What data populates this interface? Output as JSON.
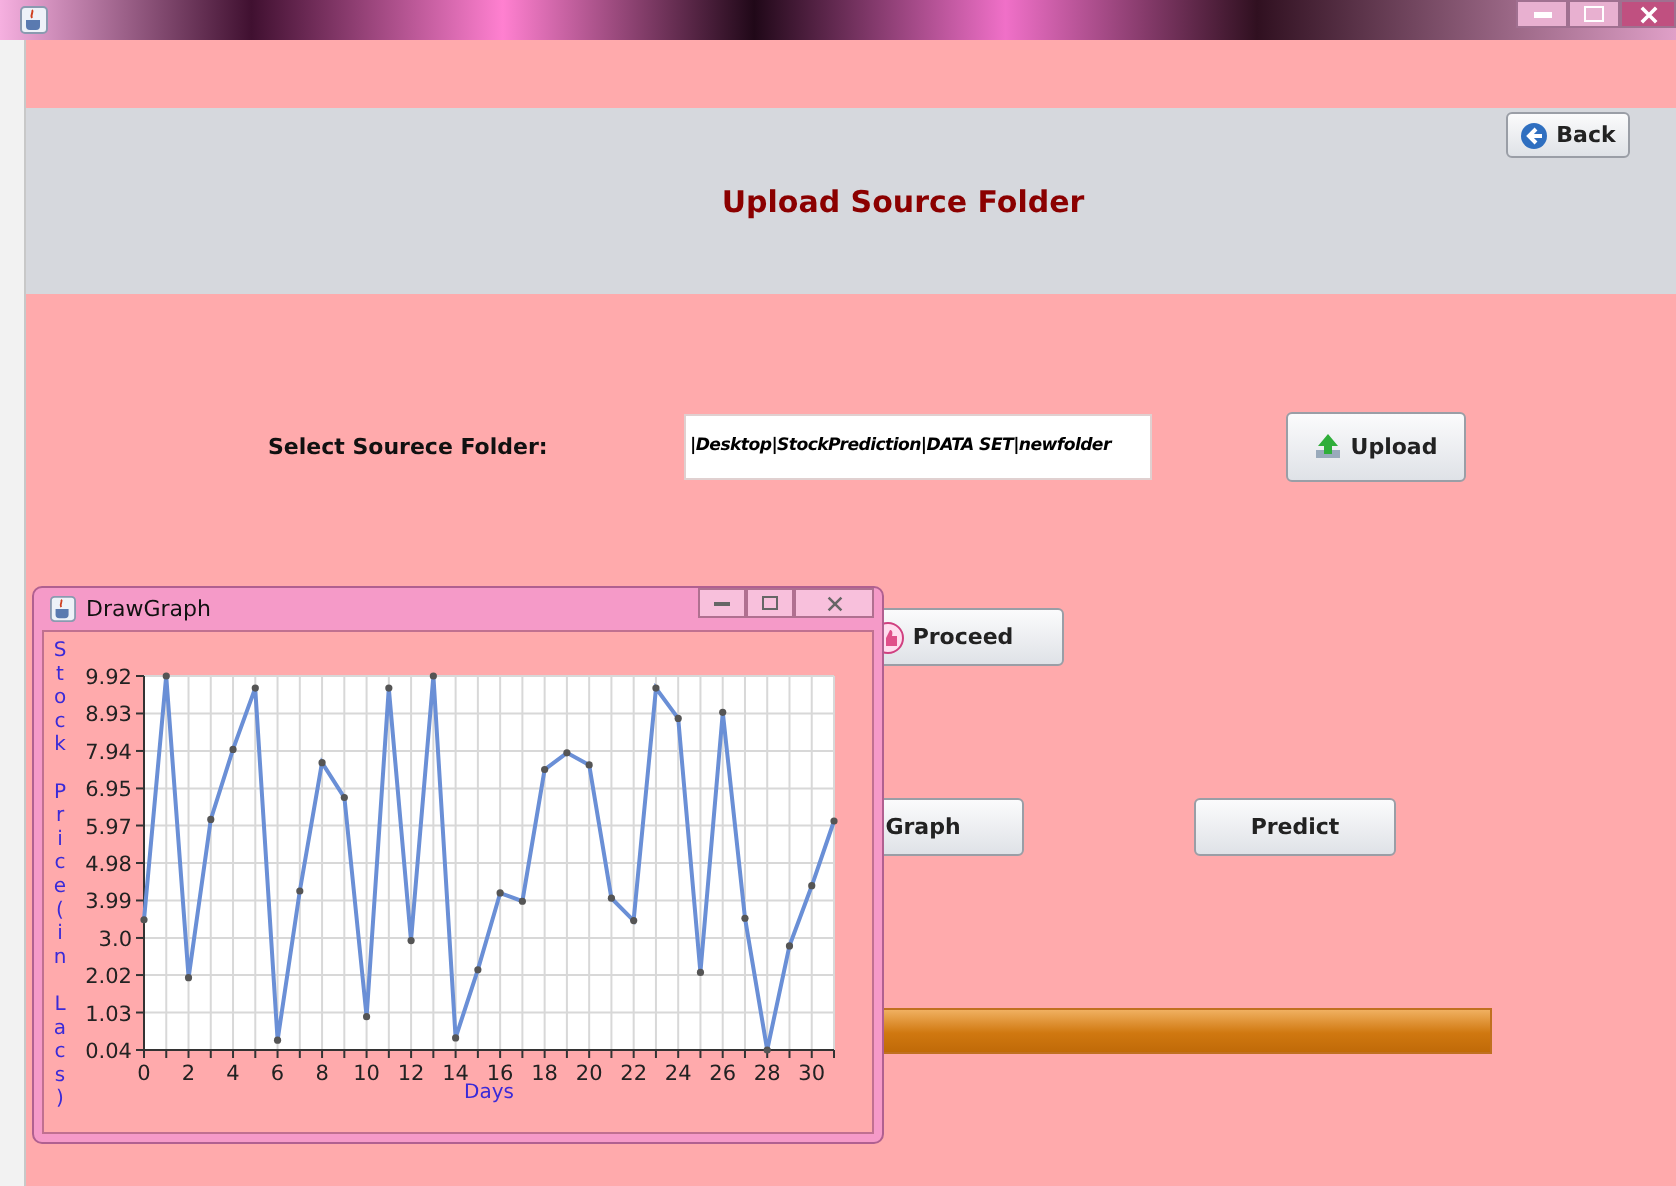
{
  "header": {
    "title": "Upload Source Folder",
    "back_button": "Back"
  },
  "folder_row": {
    "label": "Select Sourece Folder:",
    "value": "|Desktop|StockPrediction|DATA SET|newfolder",
    "upload_button": "Upload"
  },
  "proceed_button": "Proceed",
  "graph_button": "Graph",
  "predict_button": "Predict",
  "progress": {
    "level": 1
  },
  "graph_window": {
    "title": "DrawGraph",
    "chart_data": {
      "type": "line",
      "xlabel": "Days",
      "ylabel": "Stock Price(in Lacs)",
      "x": [
        0,
        1,
        2,
        3,
        4,
        5,
        6,
        7,
        8,
        9,
        10,
        11,
        12,
        13,
        14,
        15,
        16,
        17,
        18,
        19,
        20,
        21,
        22,
        23,
        24,
        25,
        26,
        27,
        28,
        29,
        30,
        31
      ],
      "grid": true,
      "series": [
        {
          "color": "#6a8fd6",
          "marker": "circle",
          "values": [
            3.48,
            9.92,
            1.95,
            6.13,
            7.98,
            9.6,
            0.3,
            4.24,
            7.63,
            6.71,
            0.92,
            9.6,
            2.93,
            9.92,
            0.36,
            2.16,
            4.19,
            3.97,
            7.45,
            7.89,
            7.57,
            4.05,
            3.46,
            9.6,
            8.8,
            2.09,
            8.96,
            3.52,
            0.04,
            2.79,
            4.38,
            6.09
          ]
        }
      ],
      "xlim": [
        0,
        31
      ],
      "ylim": [
        0.04,
        9.92
      ],
      "xticks": [
        0,
        2,
        4,
        6,
        8,
        10,
        12,
        14,
        16,
        18,
        20,
        22,
        24,
        26,
        28,
        30
      ],
      "yticks": [
        0.04,
        1.03,
        2.02,
        {
          "value": 3,
          "label": "3.0"
        },
        3.99,
        4.98,
        5.97,
        6.95,
        7.94,
        8.93,
        9.92
      ]
    }
  }
}
